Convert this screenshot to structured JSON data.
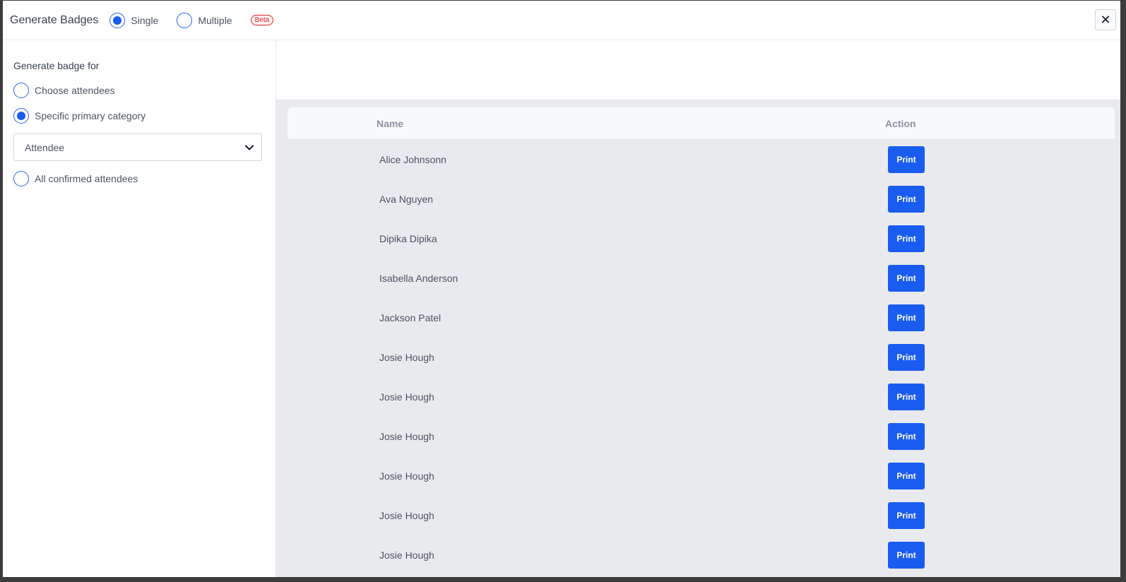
{
  "header": {
    "title": "Generate Badges",
    "mode_options": [
      {
        "label": "Single",
        "checked": true
      },
      {
        "label": "Multiple",
        "checked": false
      }
    ],
    "beta_badge": "Beta",
    "close_icon": "close-icon",
    "close_glyph": "✕"
  },
  "sidebar": {
    "section_label": "Generate badge for",
    "options": [
      {
        "label": "Choose attendees",
        "checked": false
      },
      {
        "label": "Specific primary category",
        "checked": true
      },
      {
        "label": "All confirmed attendees",
        "checked": false
      }
    ],
    "category_select": {
      "value": "Attendee",
      "icon": "chevron-down-icon"
    }
  },
  "table": {
    "columns": [
      "Name",
      "Action"
    ],
    "print_label": "Print",
    "rows": [
      {
        "name": "Alice Johnsonn"
      },
      {
        "name": "Ava Nguyen"
      },
      {
        "name": "Dipika Dipika"
      },
      {
        "name": "Isabella Anderson"
      },
      {
        "name": "Jackson Patel"
      },
      {
        "name": "Josie Hough"
      },
      {
        "name": "Josie Hough"
      },
      {
        "name": "Josie Hough"
      },
      {
        "name": "Josie Hough"
      },
      {
        "name": "Josie Hough"
      },
      {
        "name": "Josie Hough"
      }
    ]
  },
  "colors": {
    "accent": "#1a5cf0",
    "beta_red": "#dc2626",
    "table_bg": "#e9eaee"
  }
}
